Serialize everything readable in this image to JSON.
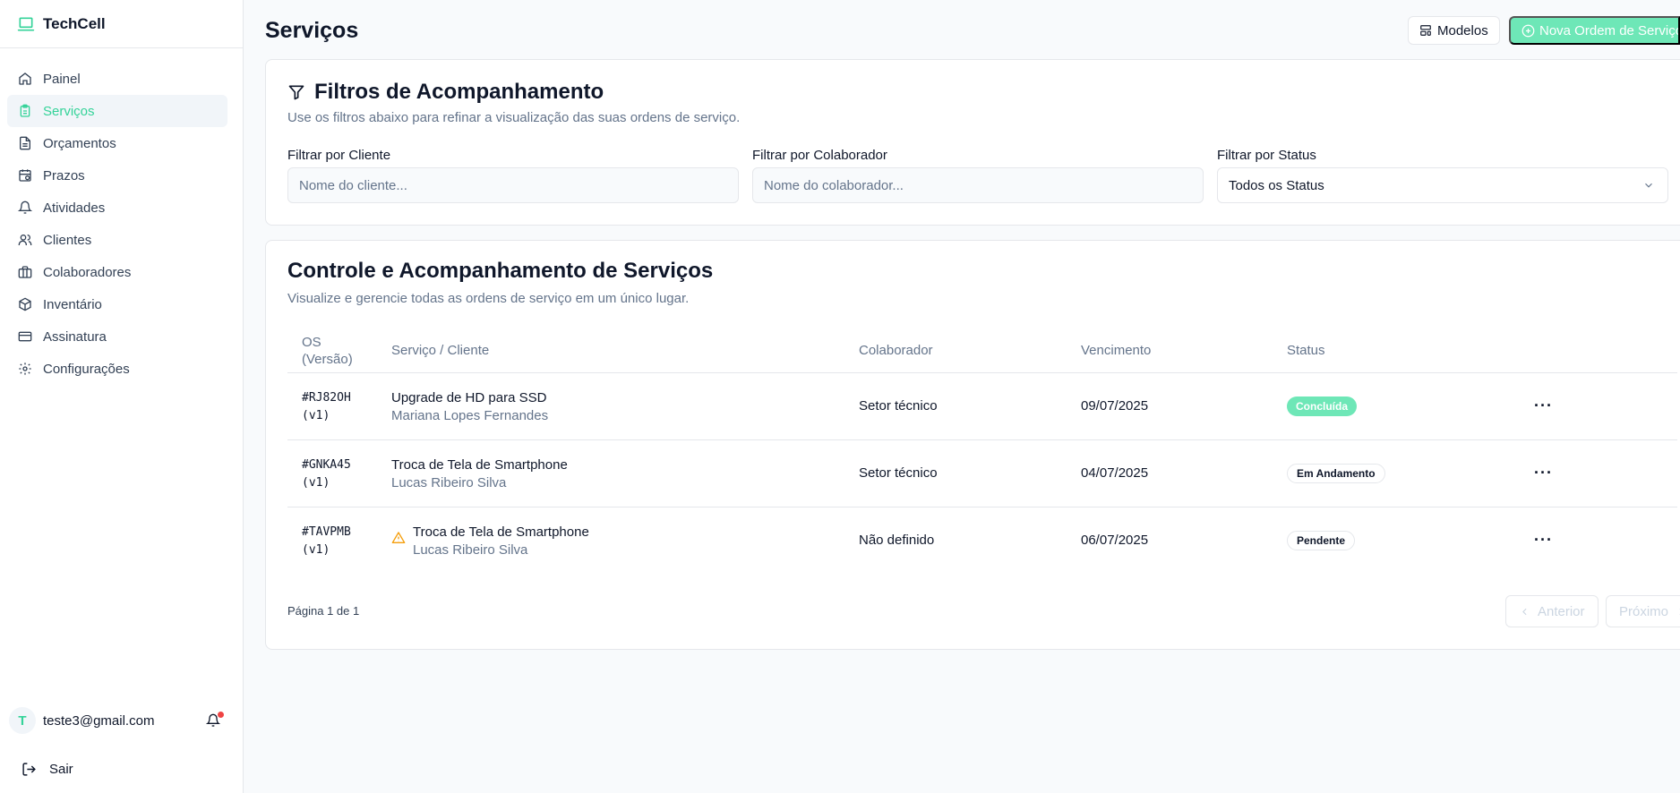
{
  "app": {
    "name": "TechCell",
    "accent": "#34d399"
  },
  "sidebar": {
    "items": [
      {
        "label": "Painel",
        "icon": "home-icon"
      },
      {
        "label": "Serviços",
        "icon": "clipboard-icon",
        "active": true
      },
      {
        "label": "Orçamentos",
        "icon": "file-text-icon"
      },
      {
        "label": "Prazos",
        "icon": "calendar-clock-icon"
      },
      {
        "label": "Atividades",
        "icon": "bell-icon"
      },
      {
        "label": "Clientes",
        "icon": "users-icon"
      },
      {
        "label": "Colaboradores",
        "icon": "briefcase-icon"
      },
      {
        "label": "Inventário",
        "icon": "package-icon"
      },
      {
        "label": "Assinatura",
        "icon": "credit-card-icon"
      },
      {
        "label": "Configurações",
        "icon": "gear-icon"
      }
    ],
    "user": {
      "initial": "T",
      "email": "teste3@gmail.com"
    },
    "logout_label": "Sair"
  },
  "header": {
    "title": "Serviços",
    "models_label": "Modelos",
    "new_order_label": "Nova Ordem de Serviço"
  },
  "filters": {
    "title": "Filtros de Acompanhamento",
    "subtitle": "Use os filtros abaixo para refinar a visualização das suas ordens de serviço.",
    "client_label": "Filtrar por Cliente",
    "client_placeholder": "Nome do cliente...",
    "collab_label": "Filtrar por Colaborador",
    "collab_placeholder": "Nome do colaborador...",
    "status_label": "Filtrar por Status",
    "status_value": "Todos os Status"
  },
  "table": {
    "title": "Controle e Acompanhamento de Serviços",
    "subtitle": "Visualize e gerencie todas as ordens de serviço em um único lugar.",
    "columns": {
      "os_line1": "OS",
      "os_line2": "(Versão)",
      "service": "Serviço / Cliente",
      "collaborator": "Colaborador",
      "due": "Vencimento",
      "status": "Status"
    },
    "rows": [
      {
        "os": "#RJ82OH",
        "version": "(v1)",
        "service": "Upgrade de HD para SSD",
        "client": "Mariana Lopes Fernandes",
        "collaborator": "Setor técnico",
        "due": "09/07/2025",
        "status": "Concluída",
        "status_color": "#6ee7b7",
        "warning": false
      },
      {
        "os": "#GNKA45",
        "version": "(v1)",
        "service": "Troca de Tela de Smartphone",
        "client": "Lucas Ribeiro Silva",
        "collaborator": "Setor técnico",
        "due": "04/07/2025",
        "status": "Em Andamento",
        "warning": false
      },
      {
        "os": "#TAVPMB",
        "version": "(v1)",
        "service": "Troca de Tela de Smartphone",
        "client": "Lucas Ribeiro Silva",
        "collaborator": "Não definido",
        "due": "06/07/2025",
        "status": "Pendente",
        "warning": true,
        "warning_color": "#f59e0b"
      }
    ],
    "pagination": {
      "text": "Página 1 de 1",
      "prev_label": "Anterior",
      "next_label": "Próximo"
    }
  }
}
